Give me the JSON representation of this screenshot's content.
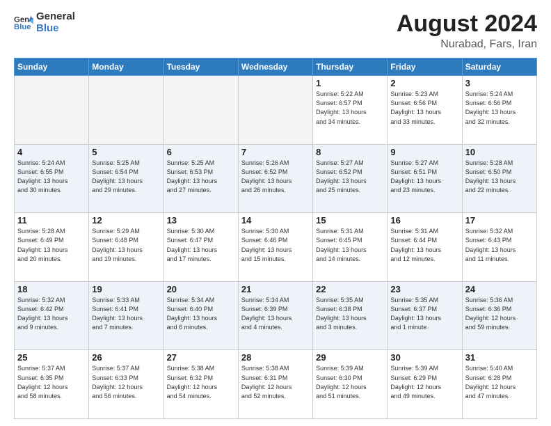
{
  "header": {
    "logo_line1": "General",
    "logo_line2": "Blue",
    "month_year": "August 2024",
    "location": "Nurabad, Fars, Iran"
  },
  "weekdays": [
    "Sunday",
    "Monday",
    "Tuesday",
    "Wednesday",
    "Thursday",
    "Friday",
    "Saturday"
  ],
  "weeks": [
    [
      {
        "day": "",
        "info": ""
      },
      {
        "day": "",
        "info": ""
      },
      {
        "day": "",
        "info": ""
      },
      {
        "day": "",
        "info": ""
      },
      {
        "day": "1",
        "info": "Sunrise: 5:22 AM\nSunset: 6:57 PM\nDaylight: 13 hours\nand 34 minutes."
      },
      {
        "day": "2",
        "info": "Sunrise: 5:23 AM\nSunset: 6:56 PM\nDaylight: 13 hours\nand 33 minutes."
      },
      {
        "day": "3",
        "info": "Sunrise: 5:24 AM\nSunset: 6:56 PM\nDaylight: 13 hours\nand 32 minutes."
      }
    ],
    [
      {
        "day": "4",
        "info": "Sunrise: 5:24 AM\nSunset: 6:55 PM\nDaylight: 13 hours\nand 30 minutes."
      },
      {
        "day": "5",
        "info": "Sunrise: 5:25 AM\nSunset: 6:54 PM\nDaylight: 13 hours\nand 29 minutes."
      },
      {
        "day": "6",
        "info": "Sunrise: 5:25 AM\nSunset: 6:53 PM\nDaylight: 13 hours\nand 27 minutes."
      },
      {
        "day": "7",
        "info": "Sunrise: 5:26 AM\nSunset: 6:52 PM\nDaylight: 13 hours\nand 26 minutes."
      },
      {
        "day": "8",
        "info": "Sunrise: 5:27 AM\nSunset: 6:52 PM\nDaylight: 13 hours\nand 25 minutes."
      },
      {
        "day": "9",
        "info": "Sunrise: 5:27 AM\nSunset: 6:51 PM\nDaylight: 13 hours\nand 23 minutes."
      },
      {
        "day": "10",
        "info": "Sunrise: 5:28 AM\nSunset: 6:50 PM\nDaylight: 13 hours\nand 22 minutes."
      }
    ],
    [
      {
        "day": "11",
        "info": "Sunrise: 5:28 AM\nSunset: 6:49 PM\nDaylight: 13 hours\nand 20 minutes."
      },
      {
        "day": "12",
        "info": "Sunrise: 5:29 AM\nSunset: 6:48 PM\nDaylight: 13 hours\nand 19 minutes."
      },
      {
        "day": "13",
        "info": "Sunrise: 5:30 AM\nSunset: 6:47 PM\nDaylight: 13 hours\nand 17 minutes."
      },
      {
        "day": "14",
        "info": "Sunrise: 5:30 AM\nSunset: 6:46 PM\nDaylight: 13 hours\nand 15 minutes."
      },
      {
        "day": "15",
        "info": "Sunrise: 5:31 AM\nSunset: 6:45 PM\nDaylight: 13 hours\nand 14 minutes."
      },
      {
        "day": "16",
        "info": "Sunrise: 5:31 AM\nSunset: 6:44 PM\nDaylight: 13 hours\nand 12 minutes."
      },
      {
        "day": "17",
        "info": "Sunrise: 5:32 AM\nSunset: 6:43 PM\nDaylight: 13 hours\nand 11 minutes."
      }
    ],
    [
      {
        "day": "18",
        "info": "Sunrise: 5:32 AM\nSunset: 6:42 PM\nDaylight: 13 hours\nand 9 minutes."
      },
      {
        "day": "19",
        "info": "Sunrise: 5:33 AM\nSunset: 6:41 PM\nDaylight: 13 hours\nand 7 minutes."
      },
      {
        "day": "20",
        "info": "Sunrise: 5:34 AM\nSunset: 6:40 PM\nDaylight: 13 hours\nand 6 minutes."
      },
      {
        "day": "21",
        "info": "Sunrise: 5:34 AM\nSunset: 6:39 PM\nDaylight: 13 hours\nand 4 minutes."
      },
      {
        "day": "22",
        "info": "Sunrise: 5:35 AM\nSunset: 6:38 PM\nDaylight: 13 hours\nand 3 minutes."
      },
      {
        "day": "23",
        "info": "Sunrise: 5:35 AM\nSunset: 6:37 PM\nDaylight: 13 hours\nand 1 minute."
      },
      {
        "day": "24",
        "info": "Sunrise: 5:36 AM\nSunset: 6:36 PM\nDaylight: 12 hours\nand 59 minutes."
      }
    ],
    [
      {
        "day": "25",
        "info": "Sunrise: 5:37 AM\nSunset: 6:35 PM\nDaylight: 12 hours\nand 58 minutes."
      },
      {
        "day": "26",
        "info": "Sunrise: 5:37 AM\nSunset: 6:33 PM\nDaylight: 12 hours\nand 56 minutes."
      },
      {
        "day": "27",
        "info": "Sunrise: 5:38 AM\nSunset: 6:32 PM\nDaylight: 12 hours\nand 54 minutes."
      },
      {
        "day": "28",
        "info": "Sunrise: 5:38 AM\nSunset: 6:31 PM\nDaylight: 12 hours\nand 52 minutes."
      },
      {
        "day": "29",
        "info": "Sunrise: 5:39 AM\nSunset: 6:30 PM\nDaylight: 12 hours\nand 51 minutes."
      },
      {
        "day": "30",
        "info": "Sunrise: 5:39 AM\nSunset: 6:29 PM\nDaylight: 12 hours\nand 49 minutes."
      },
      {
        "day": "31",
        "info": "Sunrise: 5:40 AM\nSunset: 6:28 PM\nDaylight: 12 hours\nand 47 minutes."
      }
    ]
  ]
}
